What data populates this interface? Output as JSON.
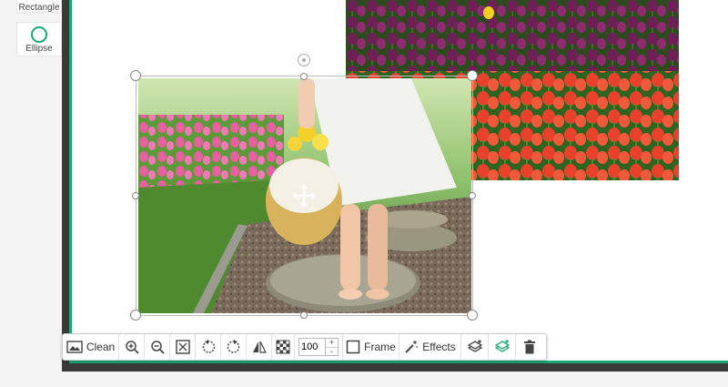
{
  "tools": {
    "rectangle_label": "Rectangle",
    "ellipse_label": "Ellipse"
  },
  "toolbar": {
    "clean_label": "Clean",
    "opacity_value": "100",
    "opacity_plus": "+",
    "opacity_minus": "-",
    "frame_label": "Frame",
    "effects_label": "Effects"
  },
  "colors": {
    "accent": "#1aa874",
    "canvas_border": "#3a3a3a"
  },
  "icons": [
    "image-icon",
    "zoom-in-icon",
    "zoom-out-icon",
    "fit-icon",
    "rotate-left-icon",
    "rotate-right-icon",
    "flip-icon",
    "transparency-icon",
    "frame-icon",
    "magic-wand-icon",
    "layer-up-icon",
    "layer-add-icon",
    "trash-icon",
    "move-icon"
  ]
}
